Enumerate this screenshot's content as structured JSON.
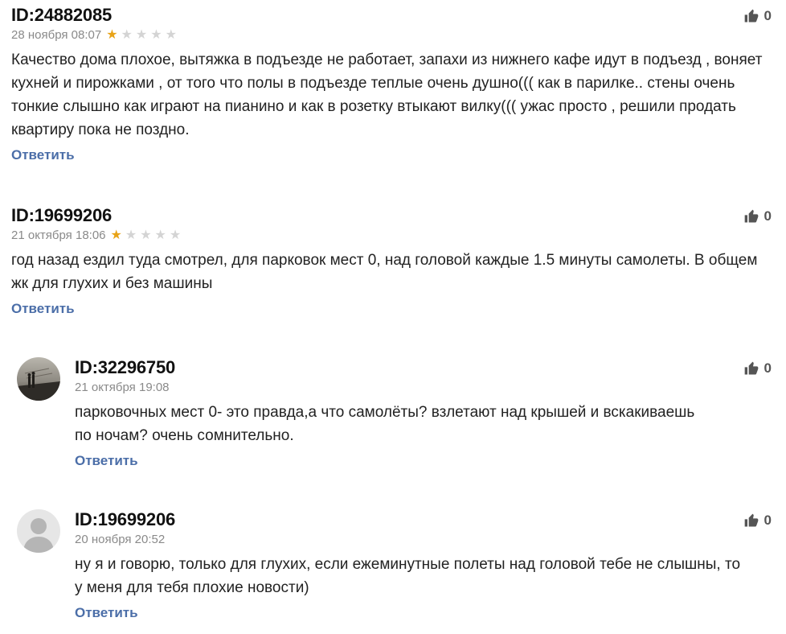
{
  "comments": [
    {
      "author": "ID:24882085",
      "date": "28 ноября 08:07",
      "rating": 1,
      "likes": "0",
      "text": "Качество дома плохое, вытяжка в подъезде не работает, запахи из нижнего кафе идут в подъезд , воняет кухней и пирожками , от того что полы в подъезде теплые очень душно((( как в парилке.. стены очень тонкие слышно как играют на пианино и как в розетку втыкают вилку((( ужас просто , решили продать квартиру пока не поздно.",
      "reply": "Ответить"
    },
    {
      "author": "ID:19699206",
      "date": "21 октября 18:06",
      "rating": 1,
      "likes": "0",
      "text": "год назад ездил туда смотрел, для парковок мест 0, над головой каждые 1.5 минуты самолеты. В общем жк для глухих и без машины",
      "reply": "Ответить"
    },
    {
      "author": "ID:32296750",
      "date": "21 октября 19:08",
      "likes": "0",
      "avatar": "photo-avatar",
      "text": "парковочных мест 0- это правда,а что самолёты? взлетают над крышей и вскакиваешь по ночам? очень сомнительно.",
      "reply": "Ответить"
    },
    {
      "author": "ID:19699206",
      "date": "20 ноября 20:52",
      "likes": "0",
      "avatar": "default-user-avatar",
      "text": "ну я и говорю, только для глухих, если ежеминутные полеты над головой тебе не слышны, то у меня для тебя плохие новости)",
      "reply": "Ответить"
    }
  ],
  "colors": {
    "star_active": "#e8a317",
    "star_inactive": "#d4d4d4",
    "reply_link": "#4b6ea8",
    "meta_text": "#8a8a8a"
  },
  "icons": {
    "like": "thumbs-up-icon",
    "star": "star-icon"
  }
}
